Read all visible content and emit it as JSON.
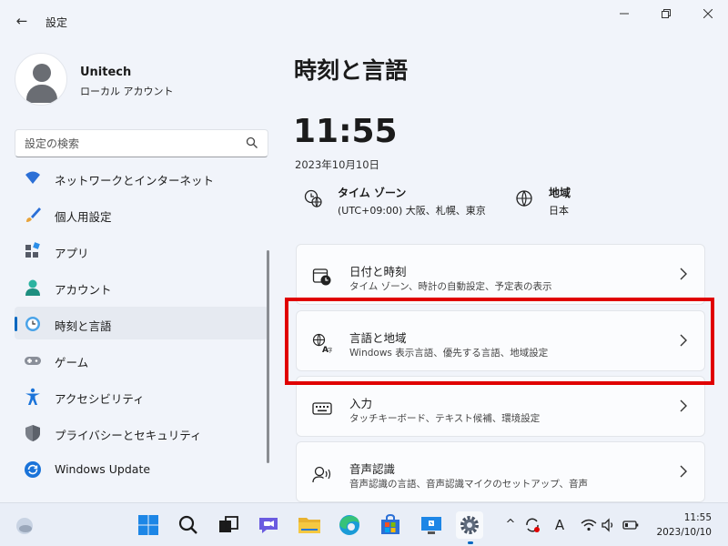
{
  "window": {
    "app_title": "設定",
    "back_glyph": "←",
    "minimize_glyph": "—",
    "maximize_glyph": "❐",
    "close_glyph": "✕"
  },
  "user": {
    "name": "Unitech",
    "account_type": "ローカル アカウント"
  },
  "search": {
    "placeholder": "設定の検索"
  },
  "sidebar": {
    "items": [
      {
        "label": "ネットワークとインターネット",
        "icon": "wifi-icon",
        "active": false
      },
      {
        "label": "個人用設定",
        "icon": "brush-icon",
        "active": false
      },
      {
        "label": "アプリ",
        "icon": "apps-icon",
        "active": false
      },
      {
        "label": "アカウント",
        "icon": "person-icon",
        "active": false
      },
      {
        "label": "時刻と言語",
        "icon": "clock-globe-icon",
        "active": true
      },
      {
        "label": "ゲーム",
        "icon": "gamepad-icon",
        "active": false
      },
      {
        "label": "アクセシビリティ",
        "icon": "accessibility-icon",
        "active": false
      },
      {
        "label": "プライバシーとセキュリティ",
        "icon": "shield-icon",
        "active": false
      },
      {
        "label": "Windows Update",
        "icon": "update-icon",
        "active": false
      }
    ]
  },
  "main": {
    "title": "時刻と言語",
    "time": "11:55",
    "date": "2023年10月10日",
    "timezone": {
      "title": "タイム ゾーン",
      "value": "(UTC+09:00) 大阪、札幌、東京"
    },
    "region": {
      "title": "地域",
      "value": "日本"
    },
    "cards": [
      {
        "title": "日付と時刻",
        "subtitle": "タイム ゾーン、時計の自動設定、予定表の表示",
        "icon": "calendar-clock-icon"
      },
      {
        "title": "言語と地域",
        "subtitle": "Windows 表示言語、優先する言語、地域設定",
        "icon": "language-icon",
        "highlighted": true
      },
      {
        "title": "入力",
        "subtitle": "タッチキーボード、テキスト候補、環境設定",
        "icon": "keyboard-icon"
      },
      {
        "title": "音声認識",
        "subtitle": "音声認識の言語、音声認識マイクのセットアップ、音声",
        "icon": "speech-icon"
      }
    ]
  },
  "colors": {
    "accent": "#0067c0",
    "highlight": "#e00000"
  },
  "taskbar": {
    "apps": [
      "start-icon",
      "search-icon",
      "task-view-icon",
      "chat-icon",
      "explorer-icon",
      "edge-icon",
      "store-icon",
      "remote-icon",
      "settings-icon"
    ],
    "active_app": "settings-icon",
    "tray": {
      "ime_label": "A",
      "chevron": "^"
    },
    "clock": {
      "time": "11:55",
      "date": "2023/10/10"
    }
  }
}
